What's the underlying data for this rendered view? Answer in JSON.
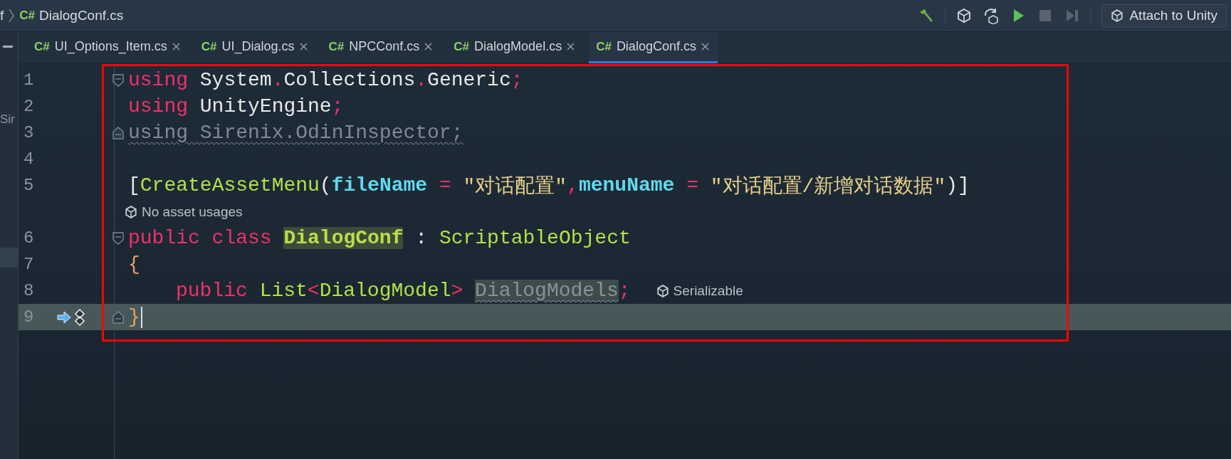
{
  "breadcrumb": {
    "parent": "f",
    "lang": "C#",
    "file": "DialogConf.cs"
  },
  "toolbar": {
    "attach_button": "Attach to Unity"
  },
  "side_panel": {
    "label": "Sir"
  },
  "tabs": [
    {
      "lang": "C#",
      "label": "UI_Options_Item.cs",
      "selected": false
    },
    {
      "lang": "C#",
      "label": "UI_Dialog.cs",
      "selected": false
    },
    {
      "lang": "C#",
      "label": "NPCConf.cs",
      "selected": false
    },
    {
      "lang": "C#",
      "label": "DialogModel.cs",
      "selected": false
    },
    {
      "lang": "C#",
      "label": "DialogConf.cs",
      "selected": true
    }
  ],
  "editor": {
    "lines": [
      {
        "kind": "code",
        "number": "1",
        "fold_start": true,
        "current": false,
        "tokens": [
          {
            "kind": "keyword",
            "text": "using"
          },
          {
            "kind": "plain",
            "text": " System"
          },
          {
            "kind": "punct",
            "text": "."
          },
          {
            "kind": "plain",
            "text": "Collections"
          },
          {
            "kind": "punct",
            "text": "."
          },
          {
            "kind": "plain",
            "text": "Generic"
          },
          {
            "kind": "punct",
            "text": ";"
          }
        ]
      },
      {
        "kind": "code",
        "number": "2",
        "current": false,
        "tokens": [
          {
            "kind": "keyword",
            "text": "using"
          },
          {
            "kind": "plain",
            "text": " UnityEngine"
          },
          {
            "kind": "punct",
            "text": ";"
          }
        ]
      },
      {
        "kind": "code",
        "number": "3",
        "fold_end": true,
        "current": false,
        "tokens": [
          {
            "kind": "unused",
            "text": "using Sirenix.OdinInspector;"
          }
        ]
      },
      {
        "kind": "code",
        "number": "4",
        "current": false
      },
      {
        "kind": "code",
        "number": "5",
        "current": false,
        "tokens": [
          {
            "kind": "plain",
            "text": "["
          },
          {
            "kind": "type",
            "text": "CreateAssetMenu"
          },
          {
            "kind": "plain",
            "text": "("
          },
          {
            "kind": "prop",
            "text": "fileName"
          },
          {
            "kind": "punct",
            "text": " = "
          },
          {
            "kind": "string",
            "text": "\"对话配置\""
          },
          {
            "kind": "punct",
            "text": ","
          },
          {
            "kind": "prop",
            "text": "menuName"
          },
          {
            "kind": "punct",
            "text": " = "
          },
          {
            "kind": "string",
            "text": "\"对话配置/新增对话数据\""
          },
          {
            "kind": "plain",
            "text": ")]"
          }
        ]
      },
      {
        "kind": "hint",
        "text": "No asset usages"
      },
      {
        "kind": "code",
        "number": "6",
        "fold_start": true,
        "current": false,
        "tokens": [
          {
            "kind": "keyword",
            "text": "public class "
          },
          {
            "kind": "decl",
            "text": "DialogConf"
          },
          {
            "kind": "plain",
            "text": " : "
          },
          {
            "kind": "type",
            "text": "ScriptableObject"
          }
        ]
      },
      {
        "kind": "code",
        "number": "7",
        "current": false,
        "tokens": [
          {
            "kind": "brace",
            "text": "{"
          }
        ]
      },
      {
        "kind": "code",
        "number": "8",
        "current": false,
        "indent": true,
        "tokens": [
          {
            "kind": "keyword",
            "text": "public "
          },
          {
            "kind": "type",
            "text": "List"
          },
          {
            "kind": "punct",
            "text": "<"
          },
          {
            "kind": "type",
            "text": "DialogModel"
          },
          {
            "kind": "punct",
            "text": "> "
          },
          {
            "kind": "unused-field",
            "text": "DialogModels"
          },
          {
            "kind": "punct",
            "text": ";"
          }
        ],
        "inlay": "Serializable"
      },
      {
        "kind": "code",
        "number": "9",
        "fold_end": true,
        "current": true,
        "tokens": [
          {
            "kind": "brace",
            "text": "}"
          }
        ]
      }
    ]
  }
}
